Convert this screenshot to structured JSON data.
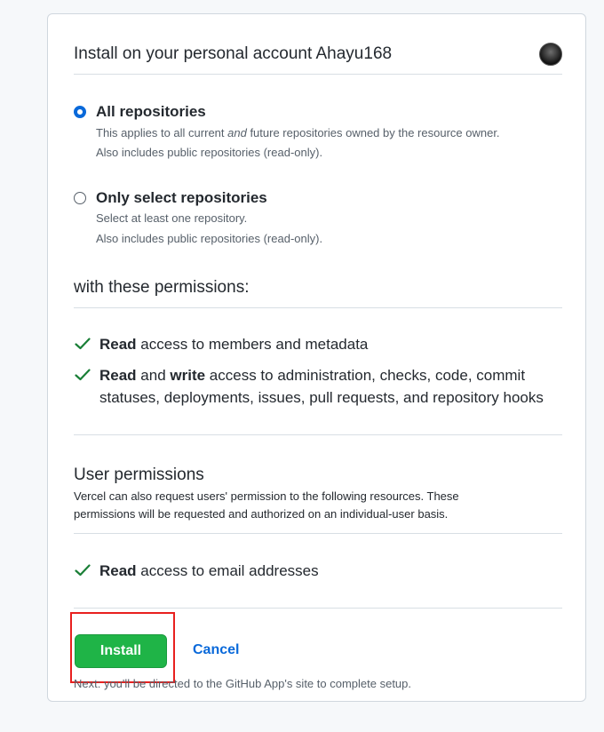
{
  "header": {
    "title": "Install on your personal account Ahayu168",
    "avatar_icon": "user-avatar-icon"
  },
  "repo_access": {
    "options": [
      {
        "label": "All repositories",
        "selected": true,
        "desc_pre": "This applies to all current ",
        "desc_em": "and",
        "desc_post": " future repositories owned by the resource owner.",
        "desc2": "Also includes public repositories (read-only)."
      },
      {
        "label": "Only select repositories",
        "selected": false,
        "desc": "Select at least one repository.",
        "desc2": "Also includes public repositories (read-only)."
      }
    ]
  },
  "permissions": {
    "title": "with these permissions:",
    "items": [
      {
        "b1": "Read",
        "t1": " access to members and metadata"
      },
      {
        "b1": "Read",
        "t1": " and ",
        "b2": "write",
        "t2": " access to administration, checks, code, commit",
        "line2": "statuses, deployments, issues, pull requests, and repository hooks"
      }
    ]
  },
  "user_permissions": {
    "title": "User permissions",
    "desc1": "Vercel can also request users' permission to the following resources. These",
    "desc2": "permissions will be requested and authorized on an individual-user basis.",
    "items": [
      {
        "b1": "Read",
        "t1": " access to email addresses"
      }
    ]
  },
  "actions": {
    "install_label": "Install",
    "cancel_label": "Cancel",
    "note": "Next: you'll be directed to the GitHub App's site to complete setup."
  },
  "colors": {
    "accent": "#0969da",
    "install_green": "#1fb447",
    "check_green": "#1a7f37",
    "highlight_red": "#e8201e"
  }
}
